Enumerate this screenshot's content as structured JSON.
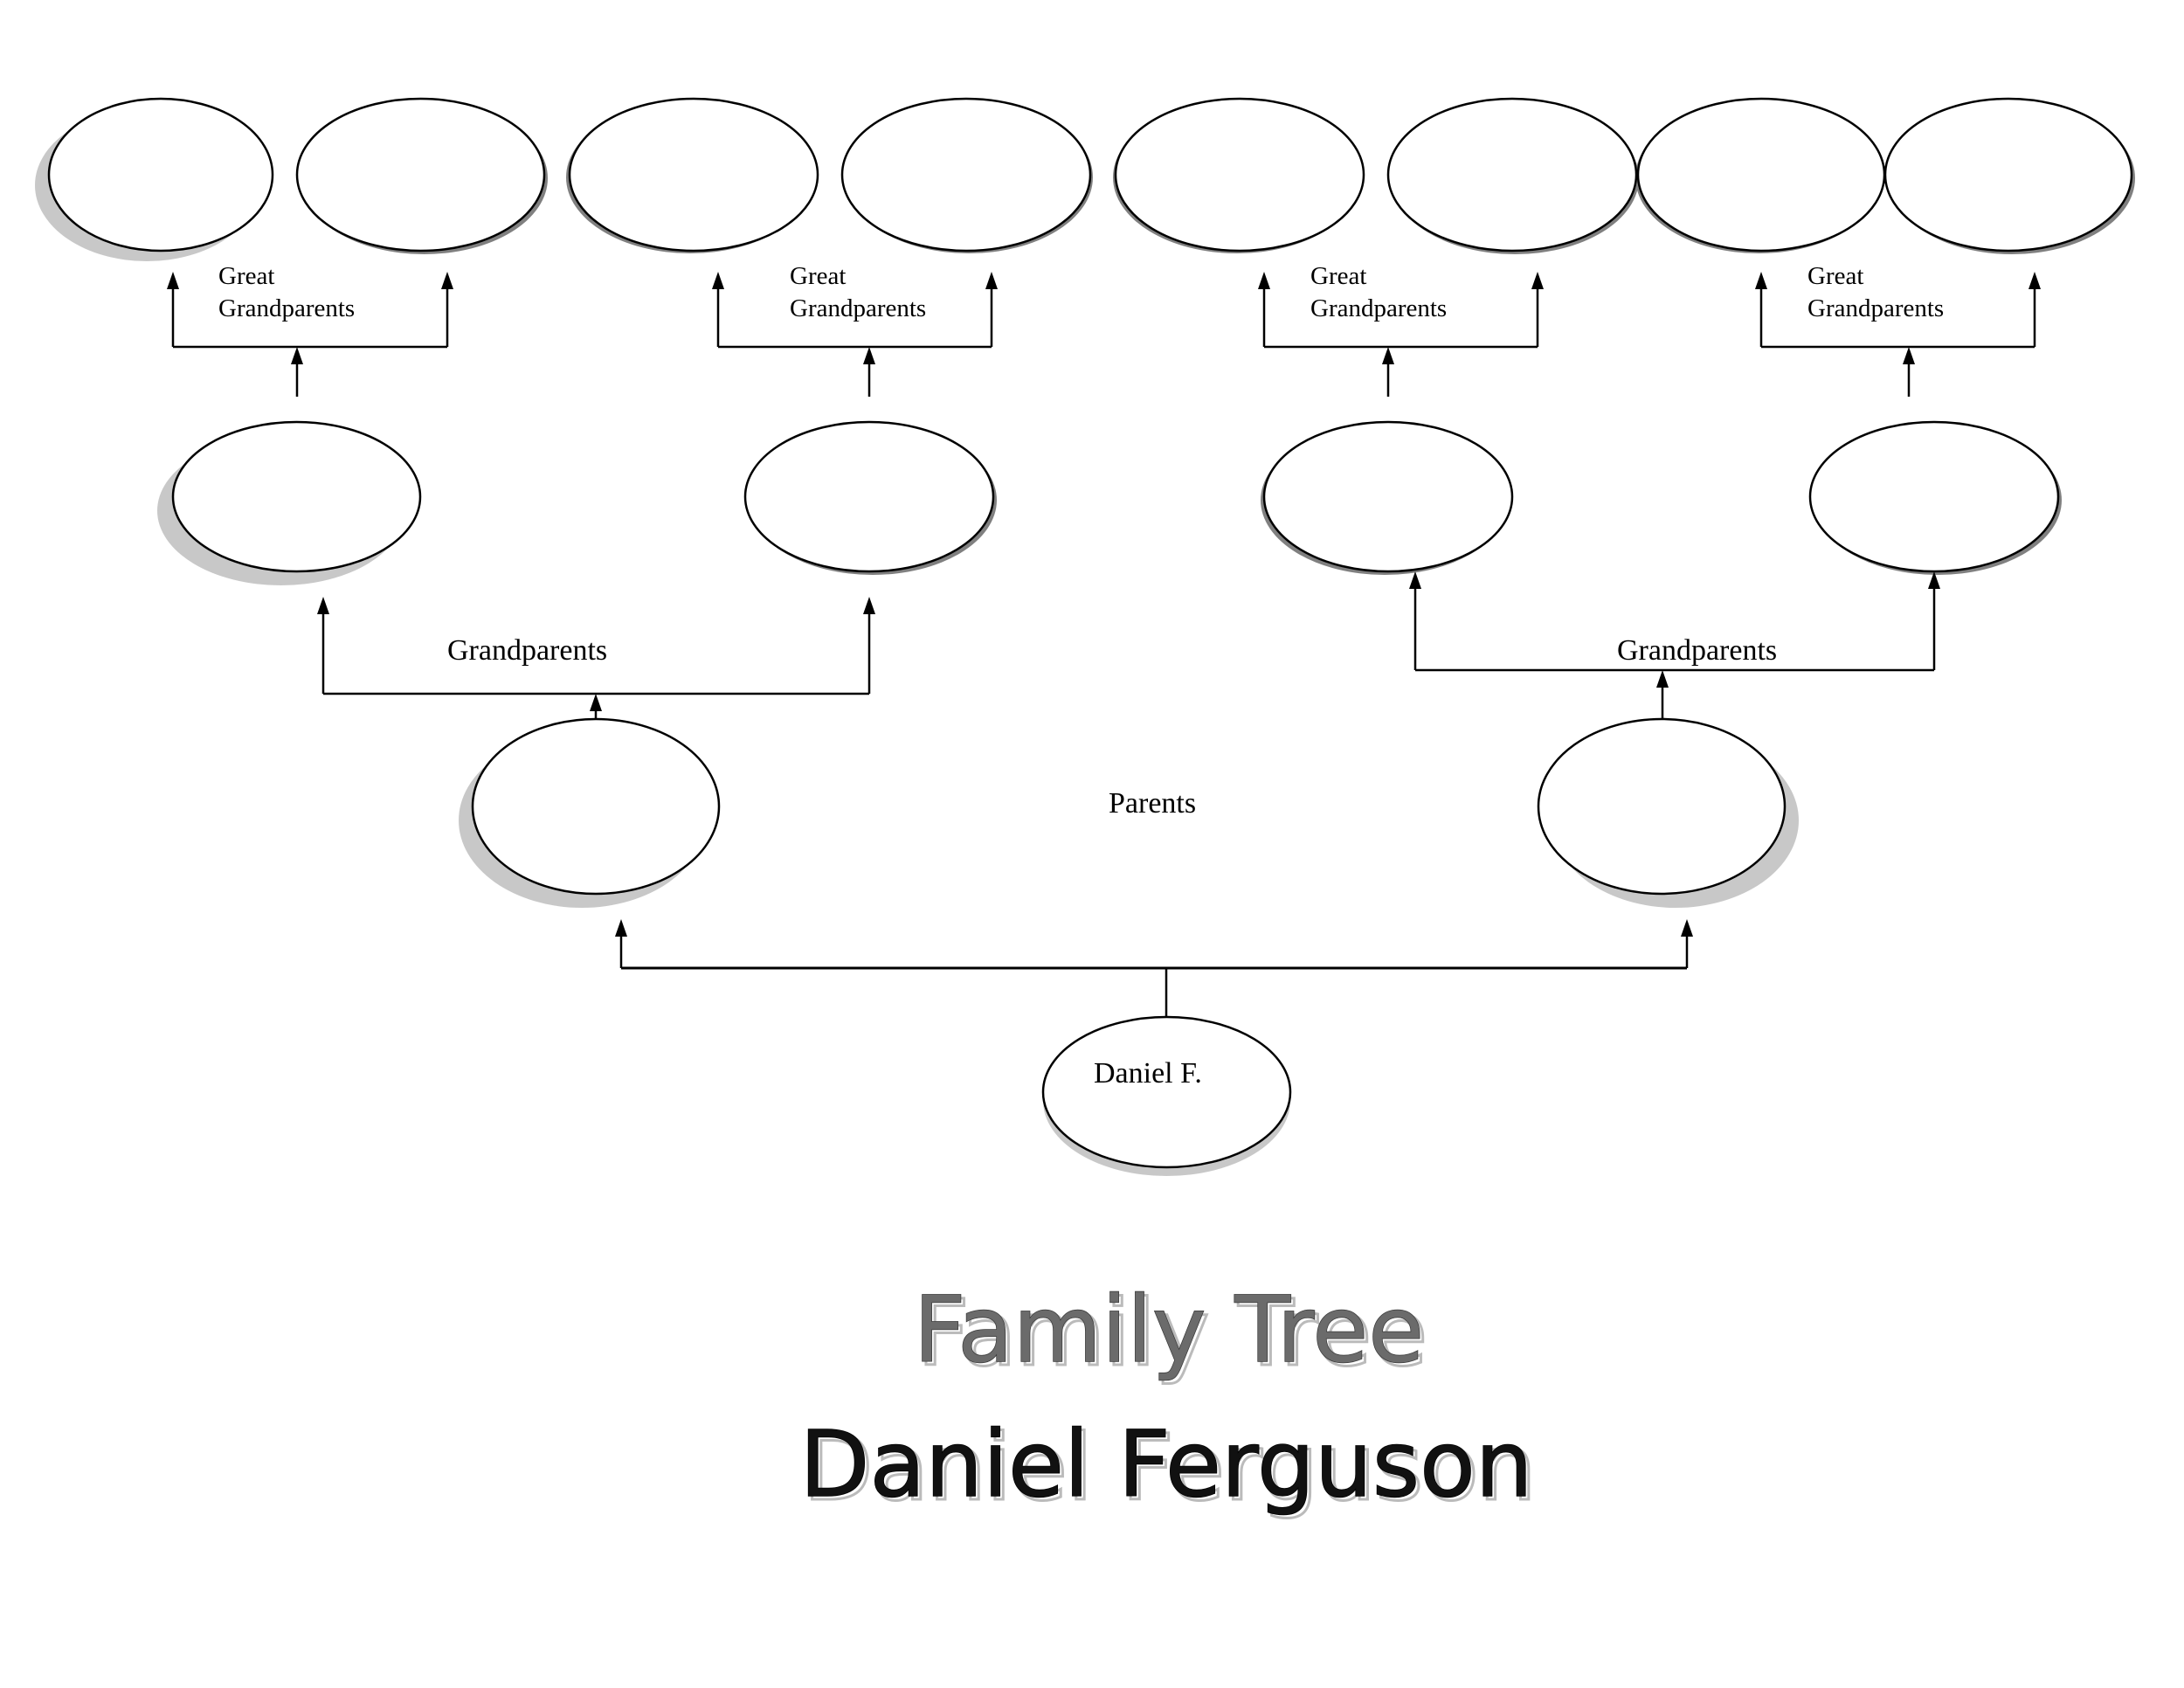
{
  "document": {
    "title": "Family Tree",
    "subject": "Daniel Ferguson"
  },
  "tree": {
    "self": {
      "label": "Daniel F."
    },
    "parents_label": "Parents",
    "grandparents_labels": [
      "Grandparents",
      "Grandparents"
    ],
    "great_grandparents_labels": [
      [
        "Great",
        "Grandparents"
      ],
      [
        "Great",
        "Grandparents"
      ],
      [
        "Great",
        "Grandparents"
      ],
      [
        "Great",
        "Grandparents"
      ]
    ],
    "parents": [
      {
        "label": ""
      },
      {
        "label": ""
      }
    ],
    "grandparents": [
      {
        "label": ""
      },
      {
        "label": ""
      },
      {
        "label": ""
      },
      {
        "label": ""
      }
    ],
    "great_grandparents": [
      {
        "label": ""
      },
      {
        "label": ""
      },
      {
        "label": ""
      },
      {
        "label": ""
      },
      {
        "label": ""
      },
      {
        "label": ""
      },
      {
        "label": ""
      },
      {
        "label": ""
      }
    ]
  },
  "colors": {
    "line": "#000000",
    "shadow_light": "#c8c8c8",
    "shadow_dark": "#808080",
    "title": "#6b6b6b",
    "subject": "#111111"
  }
}
